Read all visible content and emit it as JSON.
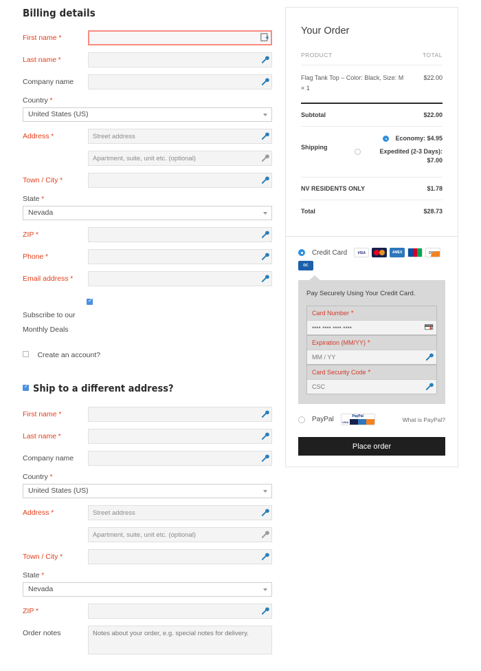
{
  "billing": {
    "heading": "Billing details",
    "fields": [
      {
        "label": "First name",
        "required": true,
        "placeholder": "",
        "error": true,
        "type": "text"
      },
      {
        "label": "Last name",
        "required": true,
        "placeholder": "",
        "error": false,
        "type": "text"
      },
      {
        "label": "Company name",
        "required": false,
        "placeholder": "",
        "error": false,
        "type": "text"
      }
    ],
    "country_label": "Country",
    "country_value": "United States (US)",
    "address_label": "Address",
    "address_placeholder": "Street address",
    "address2_placeholder": "Apartment, suite, unit etc. (optional)",
    "city_label": "Town / City",
    "city_placeholder": "",
    "state_label": "State",
    "state_value": "Nevada",
    "zip_label": "ZIP",
    "zip_placeholder": "",
    "phone_label": "Phone",
    "phone_placeholder": "",
    "email_label": "Email address",
    "email_placeholder": "",
    "subscribe_label": "Subscribe to our Monthly Deals",
    "subscribe_checked": true,
    "create_account_label": "Create an account?",
    "create_account_checked": false
  },
  "shipping": {
    "heading": "Ship to a different address?",
    "checked": true,
    "first_name_label": "First name",
    "last_name_label": "Last name",
    "company_label": "Company name",
    "country_label": "Country",
    "country_value": "United States (US)",
    "address_label": "Address",
    "address_placeholder": "Street address",
    "address2_placeholder": "Apartment, suite, unit etc. (optional)",
    "city_label": "Town / City",
    "state_label": "State",
    "state_value": "Nevada",
    "zip_label": "ZIP",
    "notes_label": "Order notes",
    "notes_placeholder": "Notes about your order, e.g. special notes for delivery."
  },
  "order": {
    "title": "Your Order",
    "col_product": "PRODUCT",
    "col_total": "TOTAL",
    "item_name": "Flag Tank Top – Color: Black, Size: M  × 1",
    "item_total": "$22.00",
    "subtotal_label": "Subtotal",
    "subtotal_value": "$22.00",
    "shipping_label": "Shipping",
    "shipping_options": [
      {
        "label": "Economy: $4.95",
        "selected": true
      },
      {
        "label": "Expedited (2-3 Days): $7.00",
        "selected": false
      }
    ],
    "tax_label": "NV RESIDENTS ONLY",
    "tax_value": "$1.78",
    "total_label": "Total",
    "total_value": "$28.73"
  },
  "payment": {
    "credit_card_label": "Credit Card",
    "credit_card_selected": true,
    "card_icons": [
      "visa-icon",
      "mastercard-icon",
      "amex-icon",
      "jcb-icon",
      "discover-icon",
      "diners-icon"
    ],
    "cc_intro": "Pay Securely Using Your Credit Card.",
    "card_number_label": "Card Number",
    "card_number_placeholder": "•••• •••• •••• ••••",
    "expiration_label": "Expiration (MM/YY)",
    "expiration_placeholder": "MM / YY",
    "csc_label": "Card Security Code",
    "csc_placeholder": "CSC",
    "paypal_label": "PayPal",
    "paypal_selected": false,
    "what_is_paypal": "What is PayPal?",
    "place_order_label": "Place order"
  },
  "colors": {
    "error": "#e2401c",
    "accent_blue": "#2f8fe0",
    "button_dark": "#1f1f1f"
  }
}
